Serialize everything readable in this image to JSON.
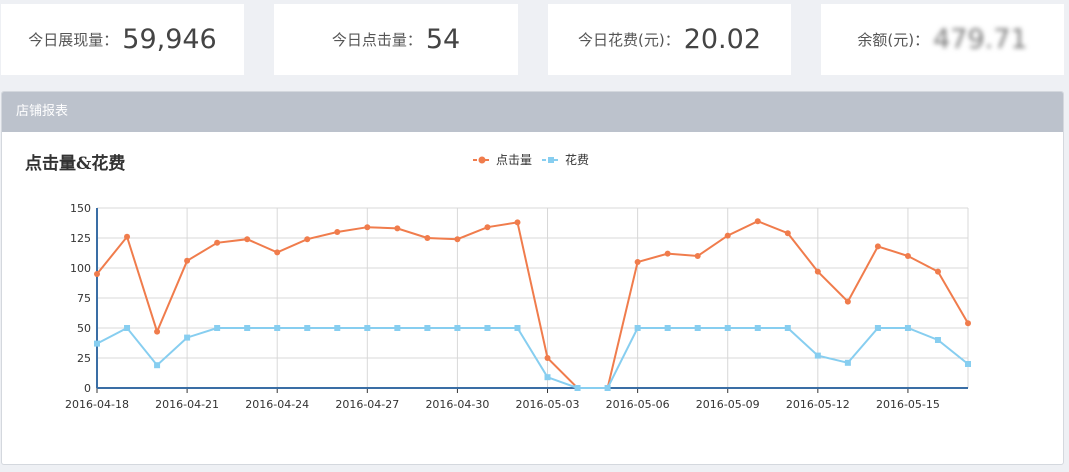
{
  "stats": [
    {
      "label": "今日展现量：",
      "value": "59,946"
    },
    {
      "label": "今日点击量：",
      "value": "54"
    },
    {
      "label": "今日花费(元)：",
      "value": "20.02"
    },
    {
      "label": "余额(元)：",
      "value": "479.71"
    }
  ],
  "panel": {
    "title": "店铺报表"
  },
  "chart_data": {
    "type": "line",
    "title": "点击量&花费",
    "x": [
      "2016-04-18",
      "2016-04-19",
      "2016-04-20",
      "2016-04-21",
      "2016-04-22",
      "2016-04-23",
      "2016-04-24",
      "2016-04-25",
      "2016-04-26",
      "2016-04-27",
      "2016-04-28",
      "2016-04-29",
      "2016-04-30",
      "2016-05-01",
      "2016-05-02",
      "2016-05-03",
      "2016-05-04",
      "2016-05-05",
      "2016-05-06",
      "2016-05-07",
      "2016-05-08",
      "2016-05-09",
      "2016-05-10",
      "2016-05-11",
      "2016-05-12",
      "2016-05-13",
      "2016-05-14",
      "2016-05-15",
      "2016-05-16",
      "2016-05-17"
    ],
    "x_tick_labels": [
      "2016-04-18",
      "2016-04-21",
      "2016-04-24",
      "2016-04-27",
      "2016-04-30",
      "2016-05-03",
      "2016-05-06",
      "2016-05-09",
      "2016-05-12",
      "2016-05-15"
    ],
    "series": [
      {
        "name": "点击量",
        "color": "#f07c4c",
        "marker": "circle",
        "values": [
          95,
          126,
          47,
          106,
          121,
          124,
          113,
          124,
          130,
          134,
          133,
          125,
          124,
          134,
          138,
          25,
          0,
          0,
          105,
          112,
          110,
          127,
          139,
          129,
          97,
          72,
          118,
          110,
          97,
          54
        ]
      },
      {
        "name": "花费",
        "color": "#87cef0",
        "marker": "square",
        "values": [
          37,
          50,
          19,
          42,
          50,
          50,
          50,
          50,
          50,
          50,
          50,
          50,
          50,
          50,
          50,
          9,
          0,
          0,
          50,
          50,
          50,
          50,
          50,
          50,
          27,
          21,
          50,
          50,
          40,
          20
        ]
      }
    ],
    "ylim": [
      0,
      150
    ],
    "yticks": [
      0,
      25,
      50,
      75,
      100,
      125,
      150
    ],
    "grid": true,
    "legend_position": "top-center"
  }
}
